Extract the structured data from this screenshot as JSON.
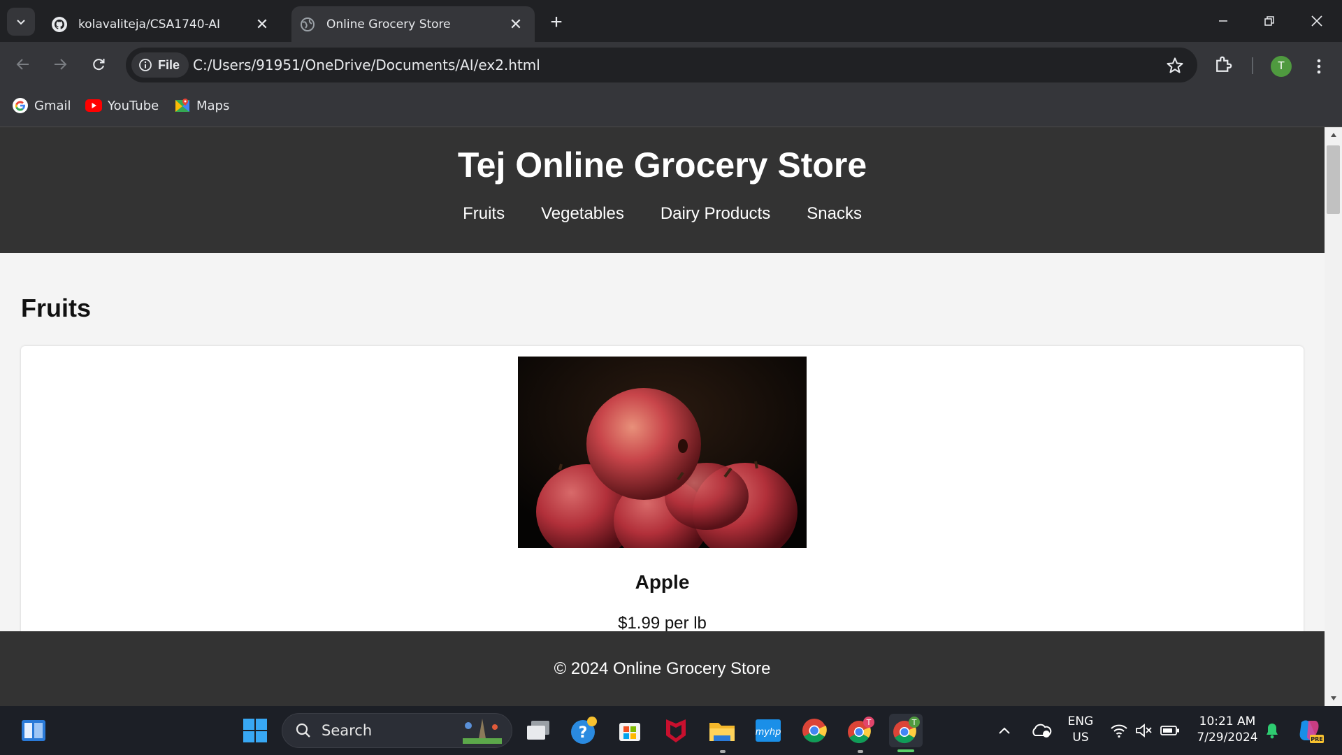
{
  "browser": {
    "tabs": [
      {
        "title": "kolavaliteja/CSA1740-AI",
        "icon": "github-icon",
        "active": false
      },
      {
        "title": "Online Grocery Store",
        "icon": "globe-icon",
        "active": true
      }
    ],
    "site_chip": "File",
    "url": "C:/Users/91951/OneDrive/Documents/AI/ex2.html",
    "profile_initial": "T",
    "bookmarks": [
      {
        "label": "Gmail",
        "icon": "google-icon"
      },
      {
        "label": "YouTube",
        "icon": "youtube-icon"
      },
      {
        "label": "Maps",
        "icon": "maps-icon"
      }
    ]
  },
  "page": {
    "site_title": "Tej Online Grocery Store",
    "nav": [
      "Fruits",
      "Vegetables",
      "Dairy Products",
      "Snacks"
    ],
    "section_title": "Fruits",
    "product": {
      "name": "Apple",
      "price": "$1.99 per lb",
      "image": "apples-photo"
    },
    "footer": "© 2024 Online Grocery Store"
  },
  "taskbar": {
    "search_label": "Search",
    "language": "ENG",
    "region": "US",
    "time": "10:21 AM",
    "date": "7/29/2024",
    "chrome_badge_1": "T",
    "chrome_badge_2": "T",
    "myhp_label": "myhp",
    "copilot_badge": "PRE"
  },
  "colors": {
    "chrome_dark": "#202124",
    "chrome_toolbar": "#35363a",
    "site_header": "#333333",
    "page_bg": "#f4f4f4",
    "profile_green": "#4f9a3f",
    "taskbar": "#1c1f26"
  }
}
